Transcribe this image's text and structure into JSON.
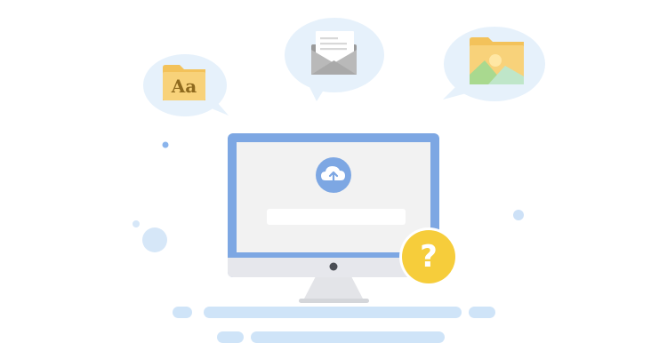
{
  "font_file_icon": {
    "label": "Aa",
    "icon": "font-folder-icon"
  },
  "mail_icon": {
    "icon": "envelope-icon"
  },
  "image_file_icon": {
    "icon": "image-folder-icon"
  },
  "upload_icon": {
    "icon": "cloud-upload-icon"
  },
  "help_badge": {
    "label": "?",
    "icon": "question-icon"
  },
  "colors": {
    "bubble": "#e6f1fb",
    "monitor_frame": "#7da7e3",
    "screen": "#f2f2f2",
    "folder": "#f8d27a",
    "help": "#f6cd3b",
    "floor": "#cfe4f8"
  }
}
